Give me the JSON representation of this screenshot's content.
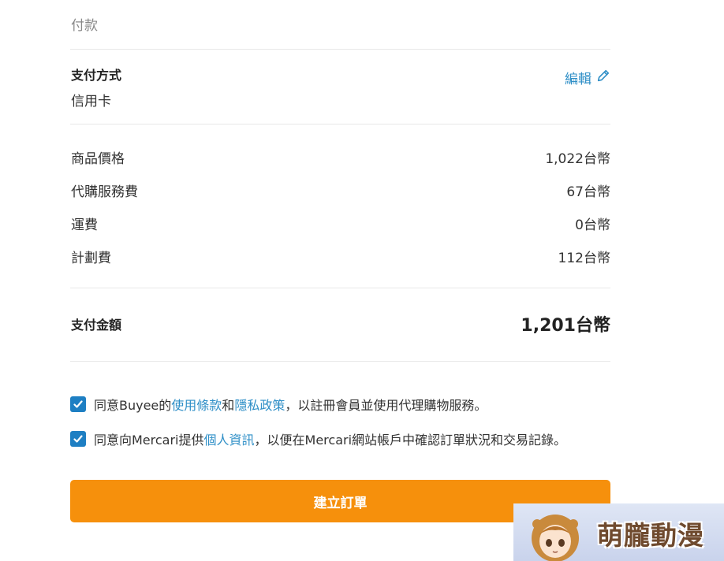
{
  "section": {
    "title": "付款"
  },
  "payment_method": {
    "title": "支付方式",
    "value": "信用卡",
    "edit_label": "編輯"
  },
  "fees": [
    {
      "label": "商品價格",
      "amount": "1,022台幣"
    },
    {
      "label": "代購服務費",
      "amount": "67台幣"
    },
    {
      "label": "運費",
      "amount": "0台幣"
    },
    {
      "label": "計劃費",
      "amount": "112台幣"
    }
  ],
  "total": {
    "label": "支付金額",
    "amount": "1,201台幣"
  },
  "agreements": [
    {
      "checked": true,
      "prefix": "同意Buyee的",
      "link1": "使用條款",
      "mid": "和",
      "link2": "隱私政策",
      "suffix": "，以註冊會員並使用代理購物服務。"
    },
    {
      "checked": true,
      "prefix": "同意向Mercari提供",
      "link1": "個人資訊",
      "suffix": "，以便在Mercari網站帳戶中確認訂單狀況和交易記錄。"
    }
  ],
  "submit": {
    "label": "建立訂單"
  },
  "watermark": {
    "text": "萌朧動漫"
  },
  "colors": {
    "accent": "#f6900c",
    "link": "#2f8fc7",
    "checkbox": "#1e7fc3"
  }
}
